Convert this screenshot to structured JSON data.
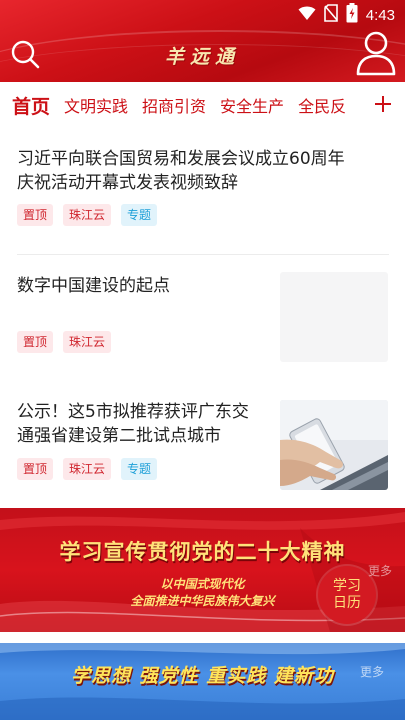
{
  "status_bar": {
    "time": "4:43"
  },
  "header": {
    "title": "羊远通"
  },
  "tabs": [
    {
      "label": "首页",
      "active": true
    },
    {
      "label": "文明实践",
      "active": false
    },
    {
      "label": "招商引资",
      "active": false
    },
    {
      "label": "安全生产",
      "active": false
    },
    {
      "label": "全民反",
      "active": false
    }
  ],
  "tab_add_label": "+",
  "news": [
    {
      "title_line1": "习近平向联合国贸易和发展会议成立60周年",
      "title_line2": "庆祝活动开幕式发表视频致辞",
      "tags": [
        "置顶",
        "珠江云",
        "专题"
      ]
    },
    {
      "title_line1": "数字中国建设的起点",
      "tags": [
        "置顶",
        "珠江云"
      ]
    },
    {
      "title_line1": "公示！这5市拟推荐获评广东交",
      "title_line2": "通强省建设第二批试点城市",
      "tags": [
        "置顶",
        "珠江云",
        "专题"
      ]
    }
  ],
  "banner1": {
    "headline": "学习宣传贯彻党的二十大精神",
    "sub1": "以中国式现代化",
    "sub2": "全面推进中华民族伟大复兴",
    "calendar_line1": "学习",
    "calendar_line2": "日历",
    "more": "更多"
  },
  "banner2": {
    "headline": "学思想 强党性 重实践 建新功",
    "more": "更多"
  },
  "colors": {
    "brand_red": "#cc1016",
    "tag_red": "#d0262f",
    "tag_blue": "#1fa0d8"
  }
}
